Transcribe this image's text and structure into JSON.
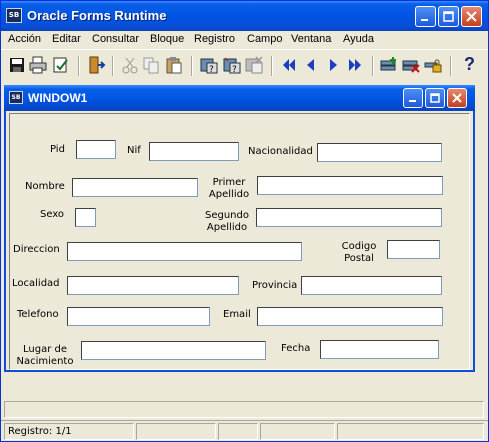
{
  "app": {
    "title": "Oracle Forms Runtime",
    "icon_text": "SB"
  },
  "menu": [
    "Acción",
    "Editar",
    "Consultar",
    "Bloque",
    "Registro",
    "Campo",
    "Ventana",
    "Ayuda"
  ],
  "toolbar": {
    "icons": [
      "save-icon",
      "print-icon",
      "exit-icon",
      "cut-icon",
      "copy-icon",
      "paste-icon",
      "enter-query-icon",
      "execute-query-icon",
      "cancel-query-icon",
      "first-record-icon",
      "previous-record-icon",
      "next-record-icon",
      "last-record-icon",
      "insert-record-icon",
      "delete-record-icon",
      "lock-record-icon",
      "help-icon"
    ],
    "help_label": "?"
  },
  "window1": {
    "title": "WINDOW1"
  },
  "form": {
    "pid": {
      "label": "Pid",
      "value": ""
    },
    "nif": {
      "label": "Nif",
      "value": ""
    },
    "nacionalidad": {
      "label": "Nacionalidad",
      "value": ""
    },
    "nombre": {
      "label": "Nombre",
      "value": ""
    },
    "primer_apellido": {
      "label_line1": "Primer",
      "label_line2": "Apellido",
      "value": ""
    },
    "sexo": {
      "label": "Sexo",
      "value": ""
    },
    "segundo_apellido": {
      "label_line1": "Segundo",
      "label_line2": "Apellido",
      "value": ""
    },
    "direccion": {
      "label": "Direccion",
      "value": ""
    },
    "codigo_postal": {
      "label_line1": "Codigo",
      "label_line2": "Postal",
      "value": ""
    },
    "localidad": {
      "label": "Localidad",
      "value": ""
    },
    "provincia": {
      "label": "Provincia",
      "value": ""
    },
    "telefono": {
      "label": "Telefono",
      "value": ""
    },
    "email": {
      "label": "Email",
      "value": ""
    },
    "lugar_nacimiento": {
      "label_line1": "Lugar de",
      "label_line2": "Nacimiento",
      "value": ""
    },
    "fecha": {
      "label": "Fecha",
      "value": ""
    }
  },
  "statusbar": {
    "record": "Registro: 1/1"
  },
  "colors": {
    "titlebar": "#0054e3",
    "window_bg": "#ece9d8",
    "close_button": "#c4401e"
  }
}
